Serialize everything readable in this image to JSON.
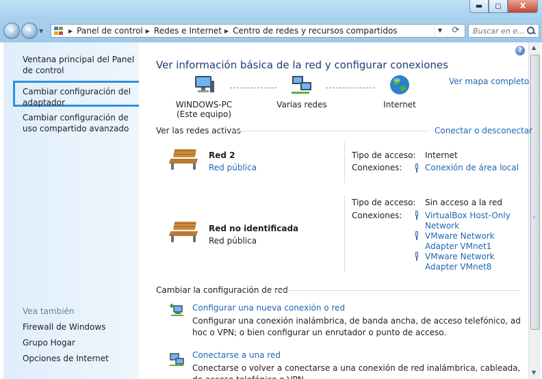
{
  "window": {
    "minimize": "▬",
    "maximize": "◻",
    "close": "X"
  },
  "address": {
    "crumbs": [
      "Panel de control",
      "Redes e Internet",
      "Centro de redes y recursos compartidos"
    ],
    "search_placeholder": "Buscar en e..."
  },
  "sidebar": {
    "items": [
      "Ventana principal del Panel de control",
      "Cambiar configuración del adaptador",
      "Cambiar configuración de uso compartido avanzado"
    ],
    "see_also_title": "Vea también",
    "see_also": [
      "Firewall de Windows",
      "Grupo Hogar",
      "Opciones de Internet"
    ]
  },
  "main": {
    "heading": "Ver información básica de la red y configurar conexiones",
    "full_map_link": "Ver mapa completo",
    "nodes": [
      {
        "label": "WINDOWS-PC",
        "sub": "(Este equipo)"
      },
      {
        "label": "Varias redes",
        "sub": ""
      },
      {
        "label": "Internet",
        "sub": ""
      }
    ],
    "active_networks_title": "Ver las redes activas",
    "connect_link": "Conectar o desconectar",
    "networks": [
      {
        "name": "Red  2",
        "type": "Red pública",
        "access_label": "Tipo de acceso:",
        "access_value": "Internet",
        "connections_label": "Conexiones:",
        "connections": [
          "Conexión de área local"
        ]
      },
      {
        "name": "Red no identificada",
        "type": "Red pública",
        "access_label": "Tipo de acceso:",
        "access_value": "Sin acceso a la red",
        "connections_label": "Conexiones:",
        "connections": [
          "VirtualBox Host-Only Network",
          "VMware Network Adapter VMnet1",
          "VMware Network Adapter VMnet8"
        ]
      }
    ],
    "change_title": "Cambiar la configuración de red",
    "tasks": [
      {
        "link": "Configurar una nueva conexión o red",
        "desc": "Configurar una conexión inalámbrica, de banda ancha, de acceso telefónico, ad hoc o VPN; o bien configurar un enrutador o punto de acceso."
      },
      {
        "link": "Conectarse a una red",
        "desc": "Conectarse o volver a conectarse a una conexión de red inalámbrica, cableada, de acceso telefónico o VPN."
      }
    ]
  }
}
